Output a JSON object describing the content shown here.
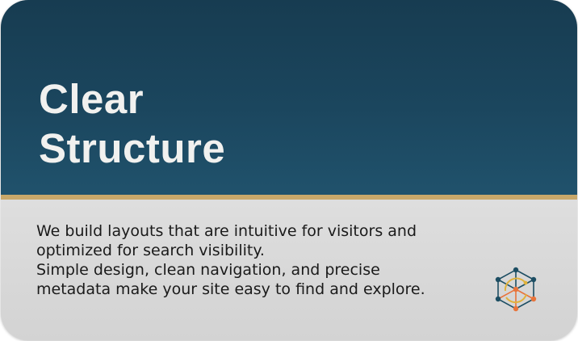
{
  "card": {
    "title_lines": [
      "Clear",
      "Structure"
    ],
    "description_lines": [
      "We build layouts that are intuitive for visitors and",
      "optimized for search visibility.",
      "Simple design, clean navigation, and precise",
      "metadata make your site easy to find and explore."
    ],
    "logo_icon": "network-cube-icon"
  },
  "colors": {
    "header": "#1b465e",
    "accent": "#c8a86a",
    "body": "#d6d6d6",
    "title_text": "#f1f1ef",
    "body_text": "#1a1a1a",
    "logo_teal": "#1d4e63",
    "logo_orange": "#e8743b",
    "logo_gold": "#e0b23c"
  }
}
